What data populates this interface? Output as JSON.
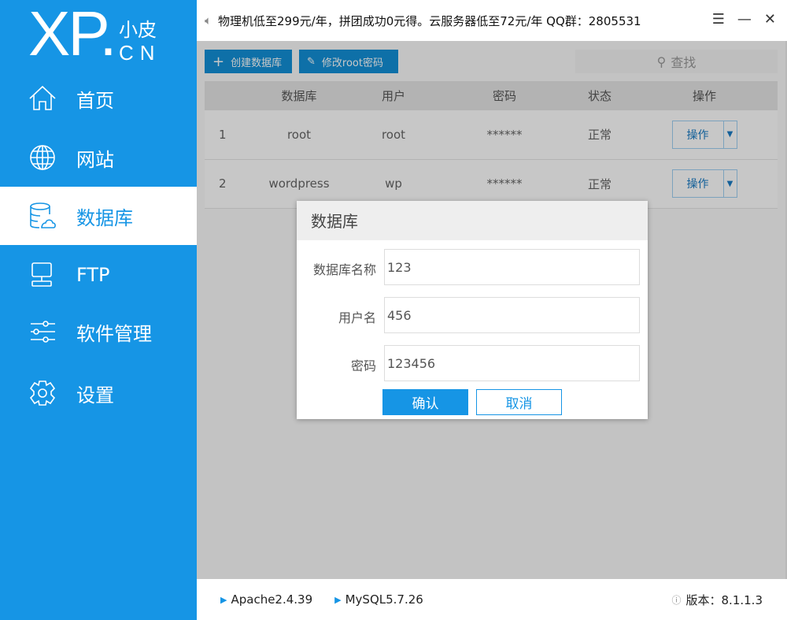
{
  "logo": {
    "main": "XP.",
    "sub1": "小皮",
    "sub2": "CN"
  },
  "sidebar": {
    "items": [
      {
        "label": "首页",
        "icon": "home-icon"
      },
      {
        "label": "网站",
        "icon": "globe-icon"
      },
      {
        "label": "数据库",
        "icon": "database-icon",
        "active": true
      },
      {
        "label": "FTP",
        "icon": "ftp-icon"
      },
      {
        "label": "软件管理",
        "icon": "sliders-icon"
      },
      {
        "label": "设置",
        "icon": "gear-icon"
      }
    ]
  },
  "topbar": {
    "notice": "物理机低至299元/年，拼团成功0元得。云服务器低至72元/年  QQ群：2805531"
  },
  "toolbar": {
    "create_label": "创建数据库",
    "change_pwd_label": "修改root密码",
    "search_label": "查找"
  },
  "table": {
    "headers": [
      "",
      "数据库",
      "用户",
      "密码",
      "状态",
      "操作"
    ],
    "rows": [
      {
        "num": "1",
        "db": "root",
        "user": "root",
        "pwd": "******",
        "status": "正常",
        "action": "操作"
      },
      {
        "num": "2",
        "db": "wordpress",
        "user": "wp",
        "pwd": "******",
        "status": "正常",
        "action": "操作"
      }
    ]
  },
  "dialog": {
    "title": "数据库",
    "fields": [
      {
        "label": "数据库名称",
        "value": "123"
      },
      {
        "label": "用户名",
        "value": "456"
      },
      {
        "label": "密码",
        "value": "123456"
      }
    ],
    "confirm": "确认",
    "cancel": "取消"
  },
  "footer": {
    "apache": "Apache2.4.39",
    "mysql": "MySQL5.7.26",
    "version": "版本：8.1.1.3"
  },
  "colors": {
    "accent": "#1695e5"
  }
}
